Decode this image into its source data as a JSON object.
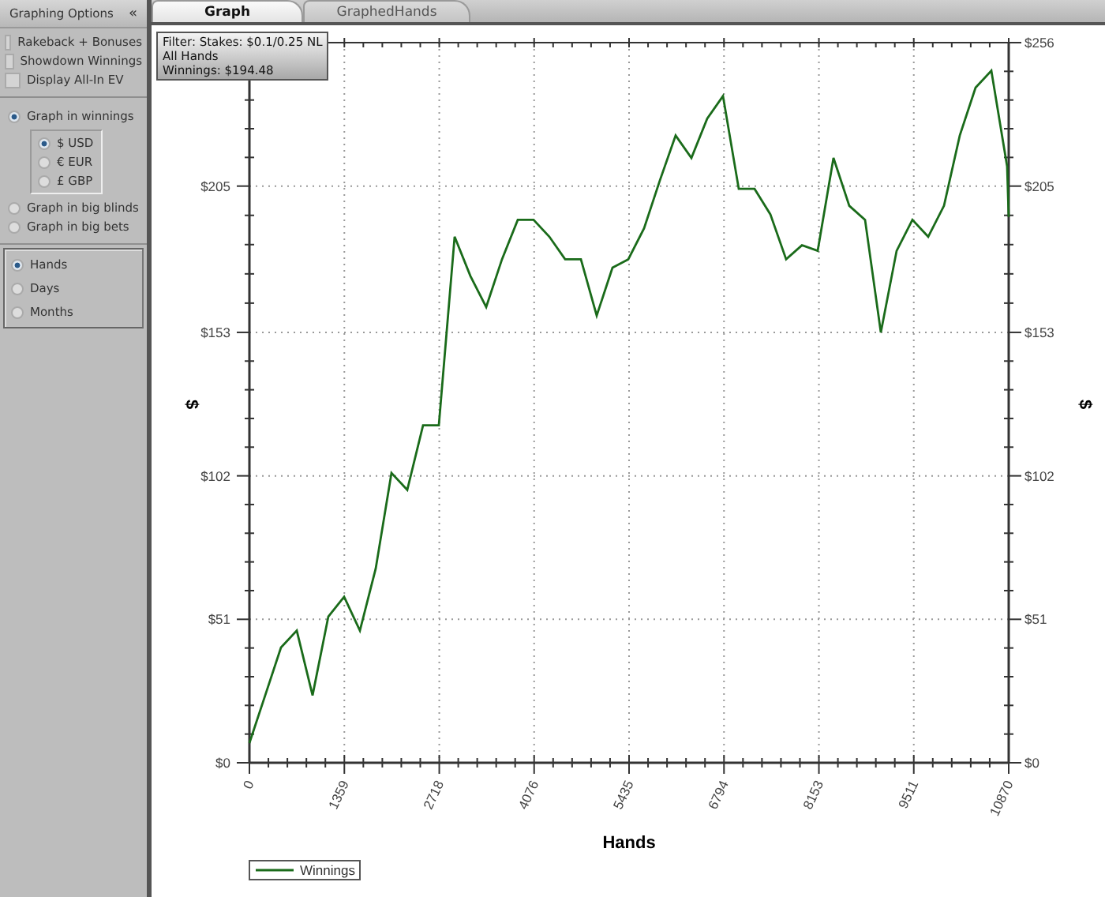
{
  "sidebar": {
    "title": "Graphing Options",
    "collapse_glyph": "«",
    "options": [
      {
        "label": "Rakeback + Bonuses",
        "checked": false
      },
      {
        "label": "Showdown Winnings",
        "checked": false
      },
      {
        "label": "Display All-In EV",
        "checked": false
      }
    ],
    "graph_modes": [
      {
        "label": "Graph in winnings",
        "selected": true,
        "currencies": [
          {
            "label": "$ USD",
            "selected": true
          },
          {
            "label": "€ EUR",
            "selected": false
          },
          {
            "label": "£ GBP",
            "selected": false
          }
        ]
      },
      {
        "label": "Graph in big blinds",
        "selected": false
      },
      {
        "label": "Graph in big bets",
        "selected": false
      }
    ],
    "periods": [
      {
        "label": "Hands",
        "selected": true
      },
      {
        "label": "Days",
        "selected": false
      },
      {
        "label": "Months",
        "selected": false
      }
    ]
  },
  "tabs": [
    {
      "label": "Graph",
      "selected": true
    },
    {
      "label": "GraphedHands",
      "selected": false
    }
  ],
  "filter_box": [
    "Filter: Stakes: $0.1/0.25 NL",
    "All Hands",
    "Winnings: $194.48"
  ],
  "right_axis_label": "$",
  "chart_data": {
    "type": "line",
    "grid": true,
    "xlabel": "Hands",
    "ylabel": "$",
    "xlim": [
      0,
      10870
    ],
    "ylim": [
      0,
      256
    ],
    "xticks": [
      0,
      1359,
      2718,
      4076,
      5435,
      6794,
      8153,
      9511,
      10870
    ],
    "yticks": [
      {
        "value": 0,
        "label": "$0"
      },
      {
        "value": 51,
        "label": "$51"
      },
      {
        "value": 102,
        "label": "$102"
      },
      {
        "value": 153,
        "label": "$153"
      },
      {
        "value": 205,
        "label": "$205"
      },
      {
        "value": 256,
        "label": "$256"
      }
    ],
    "x": [
      0,
      226,
      452,
      678,
      904,
      1130,
      1356,
      1582,
      1808,
      2034,
      2260,
      2486,
      2712,
      2938,
      3164,
      3390,
      3616,
      3842,
      4068,
      4294,
      4520,
      4746,
      4972,
      5198,
      5424,
      5650,
      5876,
      6102,
      6328,
      6554,
      6780,
      7006,
      7232,
      7458,
      7684,
      7910,
      8136,
      8362,
      8588,
      8814,
      9040,
      9266,
      9492,
      9718,
      9944,
      10170,
      10396,
      10622,
      10848,
      10870
    ],
    "series": [
      {
        "name": "Winnings",
        "color": "#1a6b1a",
        "values": [
          7,
          24,
          41,
          47,
          24,
          52,
          59,
          47,
          69,
          103,
          97,
          120,
          120,
          187,
          173,
          162,
          179,
          193,
          193,
          187,
          179,
          179,
          159,
          176,
          179,
          190,
          207,
          223,
          215,
          229,
          237,
          204,
          204,
          195,
          179,
          184,
          182,
          215,
          198,
          193,
          153,
          182,
          193,
          187,
          198,
          223,
          240,
          246,
          212,
          194
        ]
      }
    ]
  }
}
